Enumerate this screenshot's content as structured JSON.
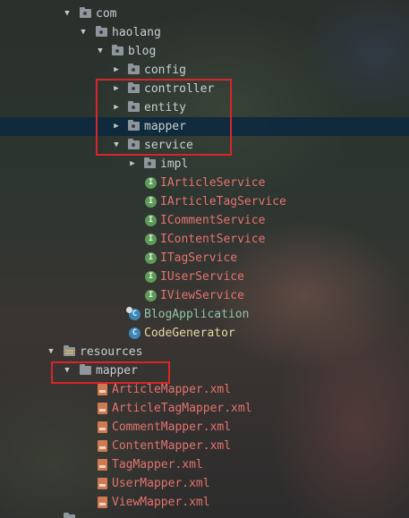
{
  "tree": {
    "com": "com",
    "haolang": "haolang",
    "blog": "blog",
    "config": "config",
    "controller": "controller",
    "entity": "entity",
    "mapper_pkg": "mapper",
    "service": "service",
    "impl": "impl",
    "interfaces": [
      "IArticleService",
      "IArticleTagService",
      "ICommentService",
      "IContentService",
      "ITagService",
      "IUserService",
      "IViewService"
    ],
    "blog_application": "BlogApplication",
    "code_generator": "CodeGenerator",
    "resources": "resources",
    "mapper_res": "mapper",
    "xml_files": [
      "ArticleMapper.xml",
      "ArticleTagMapper.xml",
      "CommentMapper.xml",
      "ContentMapper.xml",
      "TagMapper.xml",
      "UserMapper.xml",
      "ViewMapper.xml"
    ]
  },
  "icons": {
    "interface_letter": "I",
    "class_letter": "C",
    "arrow_expanded": "▼",
    "arrow_collapsed": "▶"
  },
  "colors": {
    "selection": "#0d293e",
    "highlight_box": "#d6262a",
    "modified_file": "#e4736e",
    "class_name": "#8fc6a2"
  }
}
